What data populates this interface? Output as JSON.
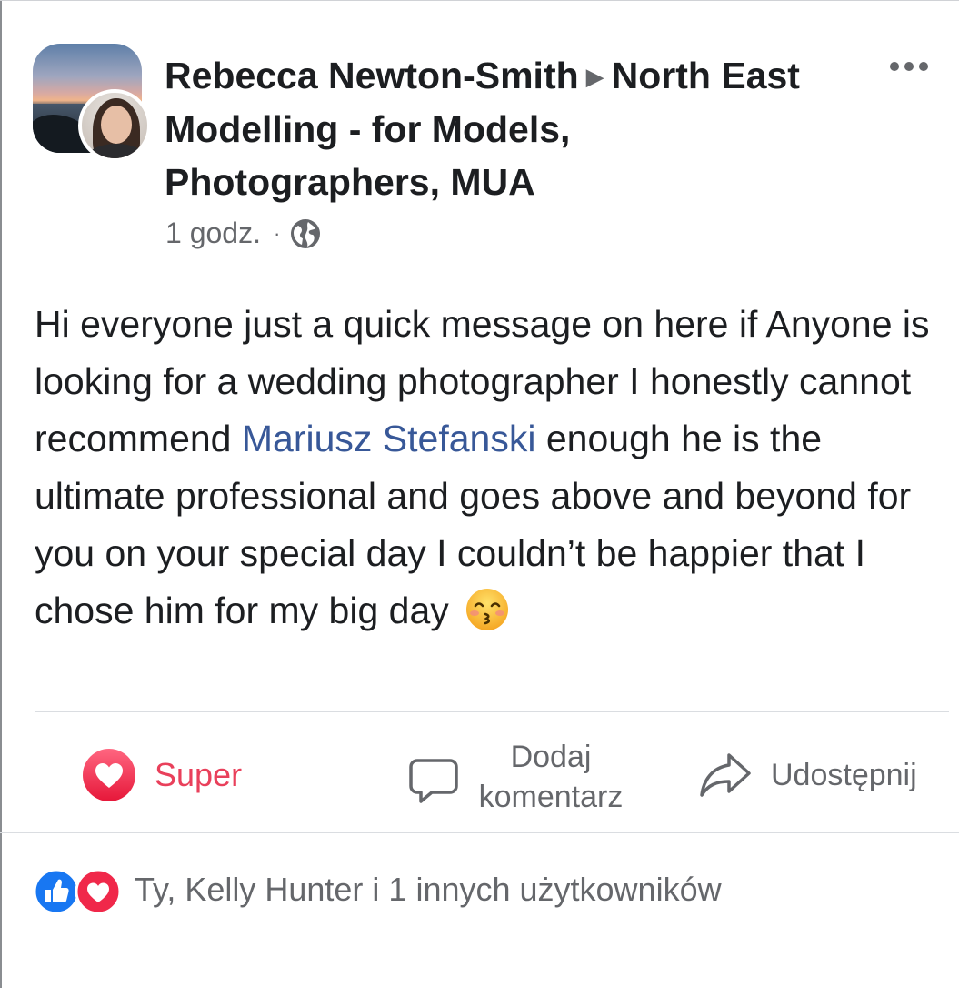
{
  "post": {
    "author": "Rebecca Newton-Smith",
    "separator": "▶",
    "group": "North East Modelling - for Models, Photographers, MUA",
    "time": "1 godz.",
    "meta_dot": "·",
    "privacy_icon": "globe-icon",
    "body_before_mention": "Hi everyone just a quick message on here if Anyone is looking for a wedding photographer I honestly cannot recommend",
    "mention": "Mariusz Stefanski",
    "body_after_mention": "enough he is the ultimate professional and goes above and beyond for you on your special day I couldn’t be happier that I chose him for my big day",
    "emoji": "kissing-face-emoji"
  },
  "actions": {
    "reaction_label": "Super",
    "comment_label_line1": "Dodaj",
    "comment_label_line2": "komentarz",
    "share_label": "Udostępnij"
  },
  "reactions_summary": {
    "icons": [
      "like-reaction-icon",
      "love-reaction-icon"
    ],
    "text": "Ty, Kelly Hunter i 1 innych użytkowników"
  },
  "colors": {
    "accent_love": "#e9405b",
    "link": "#385898",
    "secondary_text": "#65676b",
    "like_blue": "#1877f2"
  }
}
